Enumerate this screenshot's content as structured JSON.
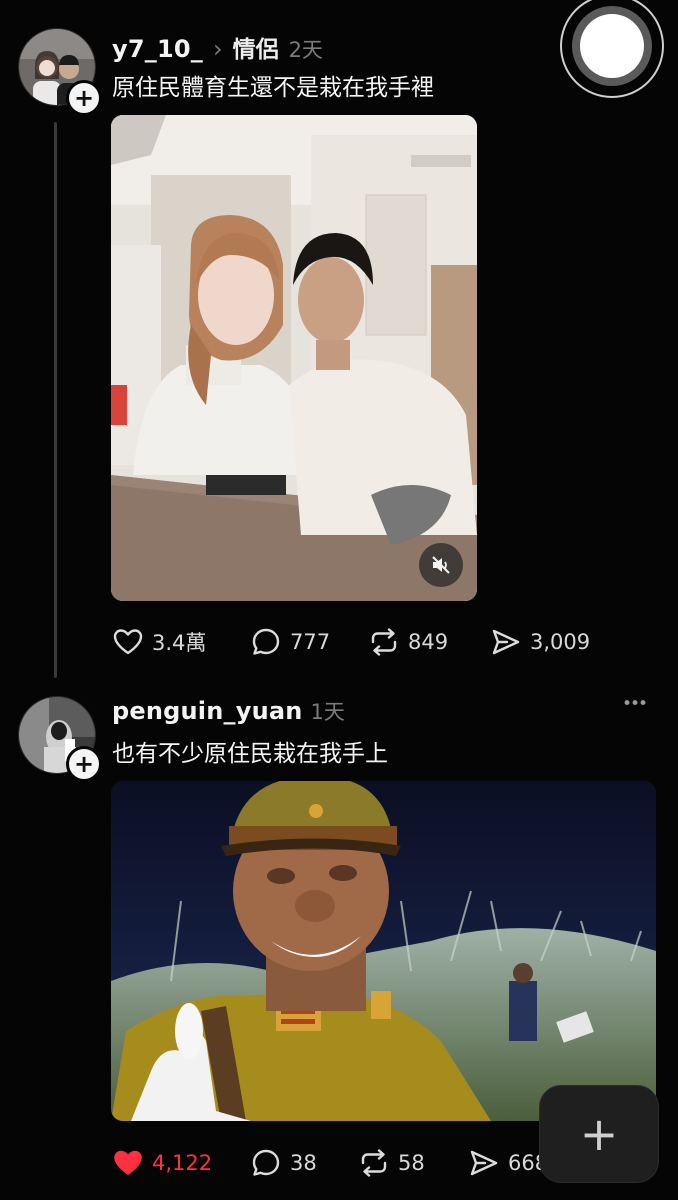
{
  "posts": [
    {
      "username": "y7_10_",
      "topic_separator": "›",
      "topic": "情侶",
      "time": "2天",
      "text": "原住民體育生還不是栽在我手裡",
      "avatar_icon": "couple-avatar",
      "media_type": "video",
      "muted": true,
      "actions": {
        "likes": "3.4萬",
        "comments": "777",
        "reposts": "849",
        "shares": "3,009"
      }
    },
    {
      "username": "penguin_yuan",
      "time": "1天",
      "text": "也有不少原住民栽在我手上",
      "avatar_icon": "penguin-avatar",
      "more_icon": "•••",
      "media_type": "image",
      "liked": true,
      "actions": {
        "likes": "4,122",
        "comments": "38",
        "reposts": "58",
        "shares": "668"
      }
    }
  ],
  "fab_icon": "+",
  "colors": {
    "background": "#050505",
    "text": "#f3f3f3",
    "muted_text": "#7b7b7b",
    "like_red": "#ff3040"
  }
}
